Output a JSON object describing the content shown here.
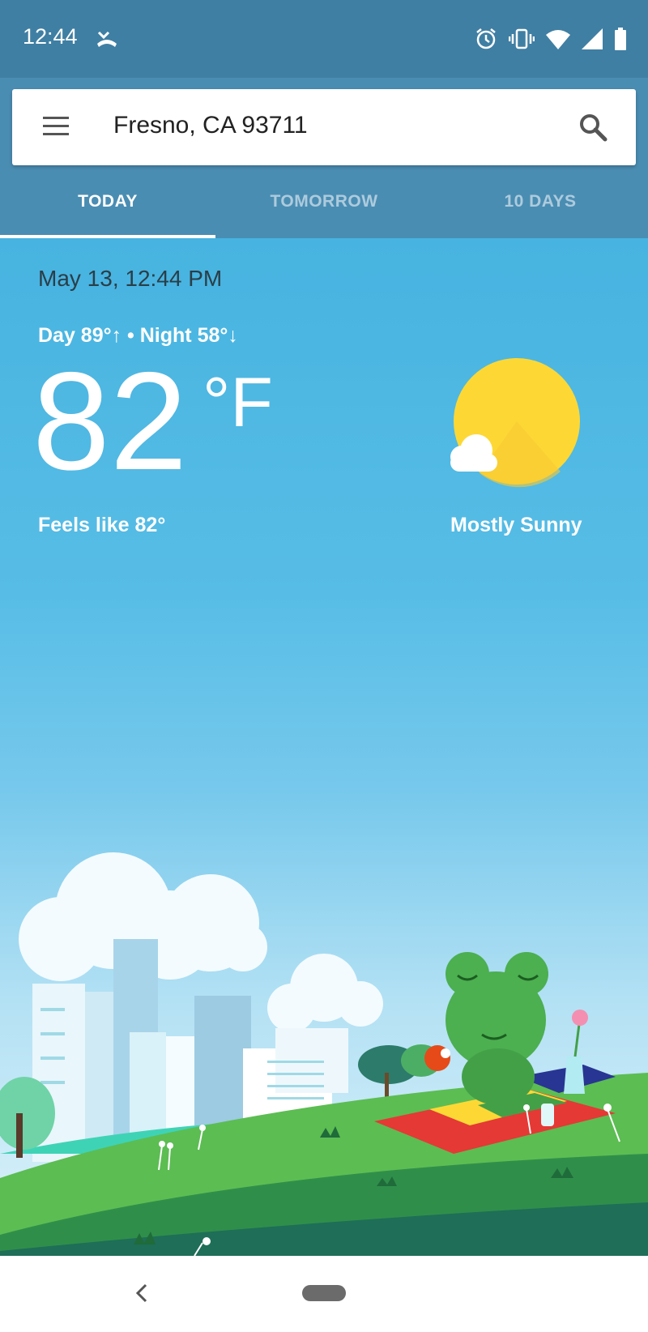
{
  "status": {
    "time": "12:44",
    "icons": [
      "missed-call-icon",
      "alarm-icon",
      "vibrate-icon",
      "wifi-icon",
      "signal-icon",
      "battery-icon"
    ]
  },
  "search": {
    "location": "Fresno, CA 93711"
  },
  "tabs": [
    {
      "label": "TODAY",
      "active": true
    },
    {
      "label": "TOMORROW",
      "active": false
    },
    {
      "label": "10 DAYS",
      "active": false
    }
  ],
  "current": {
    "datetime": "May 13, 12:44 PM",
    "day_night": "Day 89°↑ • Night 58°↓",
    "temperature": "82",
    "unit": "°F",
    "feels_like": "Feels like 82°",
    "condition": "Mostly Sunny",
    "icon": "mostly-sunny-icon"
  },
  "colors": {
    "status_bar": "#3f7fa3",
    "header": "#4a8db3",
    "sky_top": "#47b3e0",
    "sun": "#fdd835"
  }
}
